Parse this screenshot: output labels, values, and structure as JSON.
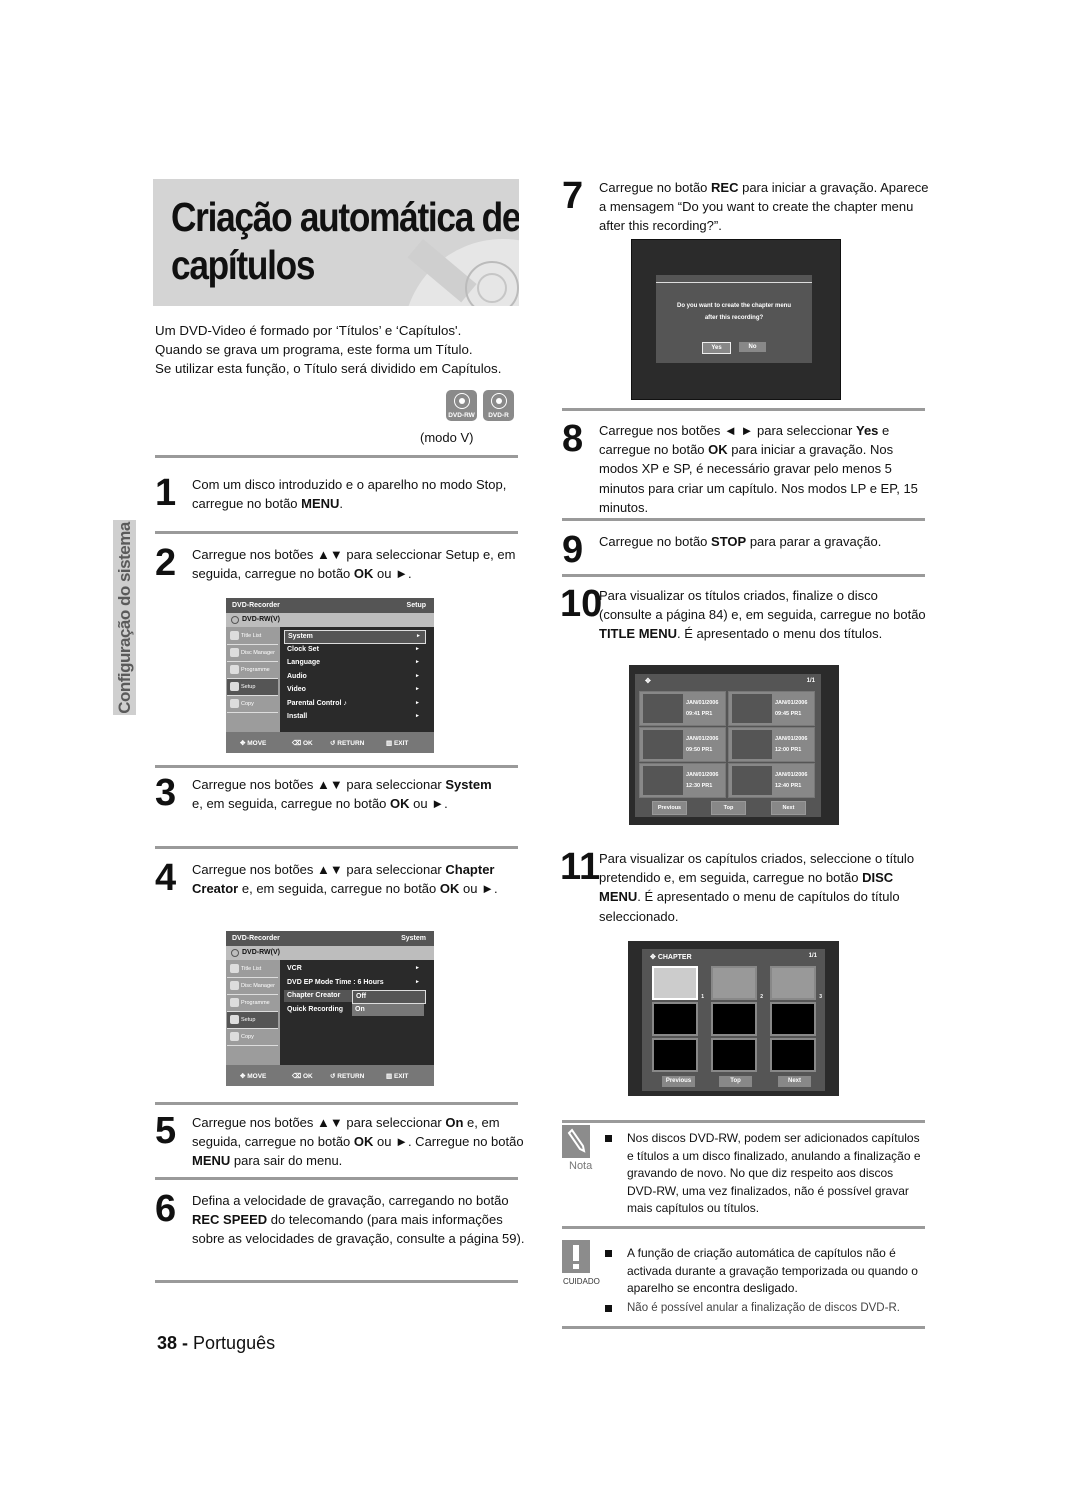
{
  "page": {
    "title_line1": "Criação automática de",
    "title_line2": "capítulos",
    "section_tab": "Configuração do sistema",
    "footer_page": "38 -",
    "footer_lang": "Português"
  },
  "intro": [
    "Um DVD-Video é formado por ‘Títulos’ e ‘Capítulos'.",
    "Quando se grava um programa, este forma um Título.",
    "Se utilizar esta função, o Título será dividido em Capítulos."
  ],
  "badges": [
    {
      "icon": "disc-icon",
      "label": "DVD-RW"
    },
    {
      "icon": "disc-icon",
      "label": "DVD-R"
    }
  ],
  "mode_label": "(modo V)",
  "steps": [
    {
      "num": "1",
      "parts": [
        [
          "Com um disco introduzido e o aparelho no modo Stop, carregue no botão ",
          false
        ],
        [
          "MENU",
          true
        ],
        [
          ".",
          false
        ]
      ]
    },
    {
      "num": "2",
      "parts": [
        [
          "Carregue nos botões ▲▼ para seleccionar Setup e, em seguida, carregue no botão ",
          false
        ],
        [
          "OK",
          true
        ],
        [
          " ou ►.",
          false
        ]
      ]
    },
    {
      "num": "3",
      "parts": [
        [
          "Carregue nos botões ▲▼ para seleccionar ",
          false
        ],
        [
          "System",
          true
        ],
        [
          " e, em seguida, carregue no botão ",
          false
        ],
        [
          "OK",
          true
        ],
        [
          " ou ►.",
          false
        ]
      ]
    },
    {
      "num": "4",
      "parts": [
        [
          "Carregue nos botões ▲▼ para seleccionar ",
          false
        ],
        [
          "Chapter Creator",
          true
        ],
        [
          " e, em seguida, carregue no botão ",
          false
        ],
        [
          "OK",
          true
        ],
        [
          " ou ►.",
          false
        ]
      ]
    },
    {
      "num": "5",
      "parts": [
        [
          "Carregue nos botões ▲▼ para seleccionar ",
          false
        ],
        [
          "On",
          true
        ],
        [
          " e, em seguida, carregue no botão ",
          false
        ],
        [
          "OK",
          true
        ],
        [
          " ou ►. Carregue no botão ",
          false
        ],
        [
          "MENU",
          true
        ],
        [
          " para sair do menu.",
          false
        ]
      ]
    },
    {
      "num": "6",
      "parts": [
        [
          "Defina a velocidade de gravação, carregando no botão ",
          false
        ],
        [
          "REC SPEED",
          true
        ],
        [
          " do telecomando (para mais informações sobre as velocidades de gravação, consulte a página 59).",
          false
        ]
      ]
    },
    {
      "num": "7",
      "parts": [
        [
          "Carregue no botão ",
          false
        ],
        [
          "REC",
          true
        ],
        [
          " para iniciar a gravação. Aparece a mensagem “Do you want to create the chapter menu after this recording?”.",
          false
        ]
      ]
    },
    {
      "num": "8",
      "parts": [
        [
          "Carregue nos botões ◄ ► para seleccionar ",
          false
        ],
        [
          "Yes",
          true
        ],
        [
          " e carregue no botão ",
          false
        ],
        [
          "OK",
          true
        ],
        [
          " para iniciar a gravação. Nos modos XP e SP, é necessário gravar pelo menos 5 minutos para criar um capítulo. Nos modos LP e EP, 15 minutos.",
          false
        ]
      ]
    },
    {
      "num": "9",
      "parts": [
        [
          "Carregue no botão ",
          false
        ],
        [
          "STOP",
          true
        ],
        [
          " para parar a gravação.",
          false
        ]
      ]
    },
    {
      "num": "10",
      "parts": [
        [
          "Para visualizar os títulos criados, finalize o disco (consulte a página 84) e, em seguida, carregue no botão ",
          false
        ],
        [
          "TITLE MENU",
          true
        ],
        [
          ". É apresentado o menu dos títulos.",
          false
        ]
      ]
    },
    {
      "num": "11",
      "parts": [
        [
          "Para visualizar os capítulos criados, seleccione o título pretendido e, em seguida, carregue no botão ",
          false
        ],
        [
          "DISC MENU",
          true
        ],
        [
          ". É apresentado o menu de capítulos do título seleccionado.",
          false
        ]
      ]
    }
  ],
  "osd_setup": {
    "header_left": "DVD-Recorder",
    "header_right": "Setup",
    "disc": "DVD-RW(V)",
    "side": [
      "Title List",
      "Disc Manager",
      "Programme",
      "Setup",
      "Copy"
    ],
    "side_selected": 3,
    "items": [
      "System",
      "Clock Set",
      "Language",
      "Audio",
      "Video",
      "Parental Control ♪",
      "Install"
    ],
    "selected": 0,
    "footer": [
      "MOVE",
      "OK",
      "RETURN",
      "EXIT"
    ]
  },
  "osd_system": {
    "header_left": "DVD-Recorder",
    "header_right": "System",
    "disc": "DVD-RW(V)",
    "side": [
      "Title List",
      "Disc Manager",
      "Programme",
      "Setup",
      "Copy"
    ],
    "side_selected": 3,
    "items": [
      "VCR",
      "DVD EP Mode Time : 6 Hours",
      "Chapter Creator",
      "Quick Recording"
    ],
    "options": [
      "Off",
      "On"
    ],
    "footer": [
      "MOVE",
      "OK",
      "RETURN",
      "EXIT"
    ]
  },
  "dialog": {
    "message_line1": "Do you want to create the chapter menu",
    "message_line2": "after this recording?",
    "yes": "Yes",
    "no": "No"
  },
  "title_menu": {
    "page": "1/1",
    "items": [
      {
        "date": "JAN/01/2006",
        "time": "09:41 PR1"
      },
      {
        "date": "JAN/01/2006",
        "time": "09:45 PR1"
      },
      {
        "date": "JAN/01/2006",
        "time": "09:50 PR1"
      },
      {
        "date": "JAN/01/2006",
        "time": "12:00 PR1"
      },
      {
        "date": "JAN/01/2006",
        "time": "12:30 PR1"
      },
      {
        "date": "JAN/01/2006",
        "time": "12:40 PR1"
      }
    ],
    "nav": [
      "Previous",
      "Top",
      "Next"
    ]
  },
  "chapter_menu": {
    "title": "CHAPTER",
    "page": "1/1",
    "numbers": [
      "1",
      "2",
      "3"
    ],
    "nav": [
      "Previous",
      "Top",
      "Next"
    ]
  },
  "note": {
    "label": "Nota",
    "items": [
      "Nos discos DVD-RW, podem ser adicionados capítulos e títulos a um disco finalizado, anulando a finalização e gravando de novo. No que diz respeito aos discos DVD-RW, uma vez finalizados, não é possível gravar mais capítulos ou títulos."
    ]
  },
  "caution": {
    "label": "CUIDADO",
    "items": [
      "A função de criação automática de capítulos não é activada durante a gravação temporizada ou quando o aparelho se encontra desligado.",
      "Não é possível anular a finalização de discos DVD-R."
    ]
  }
}
